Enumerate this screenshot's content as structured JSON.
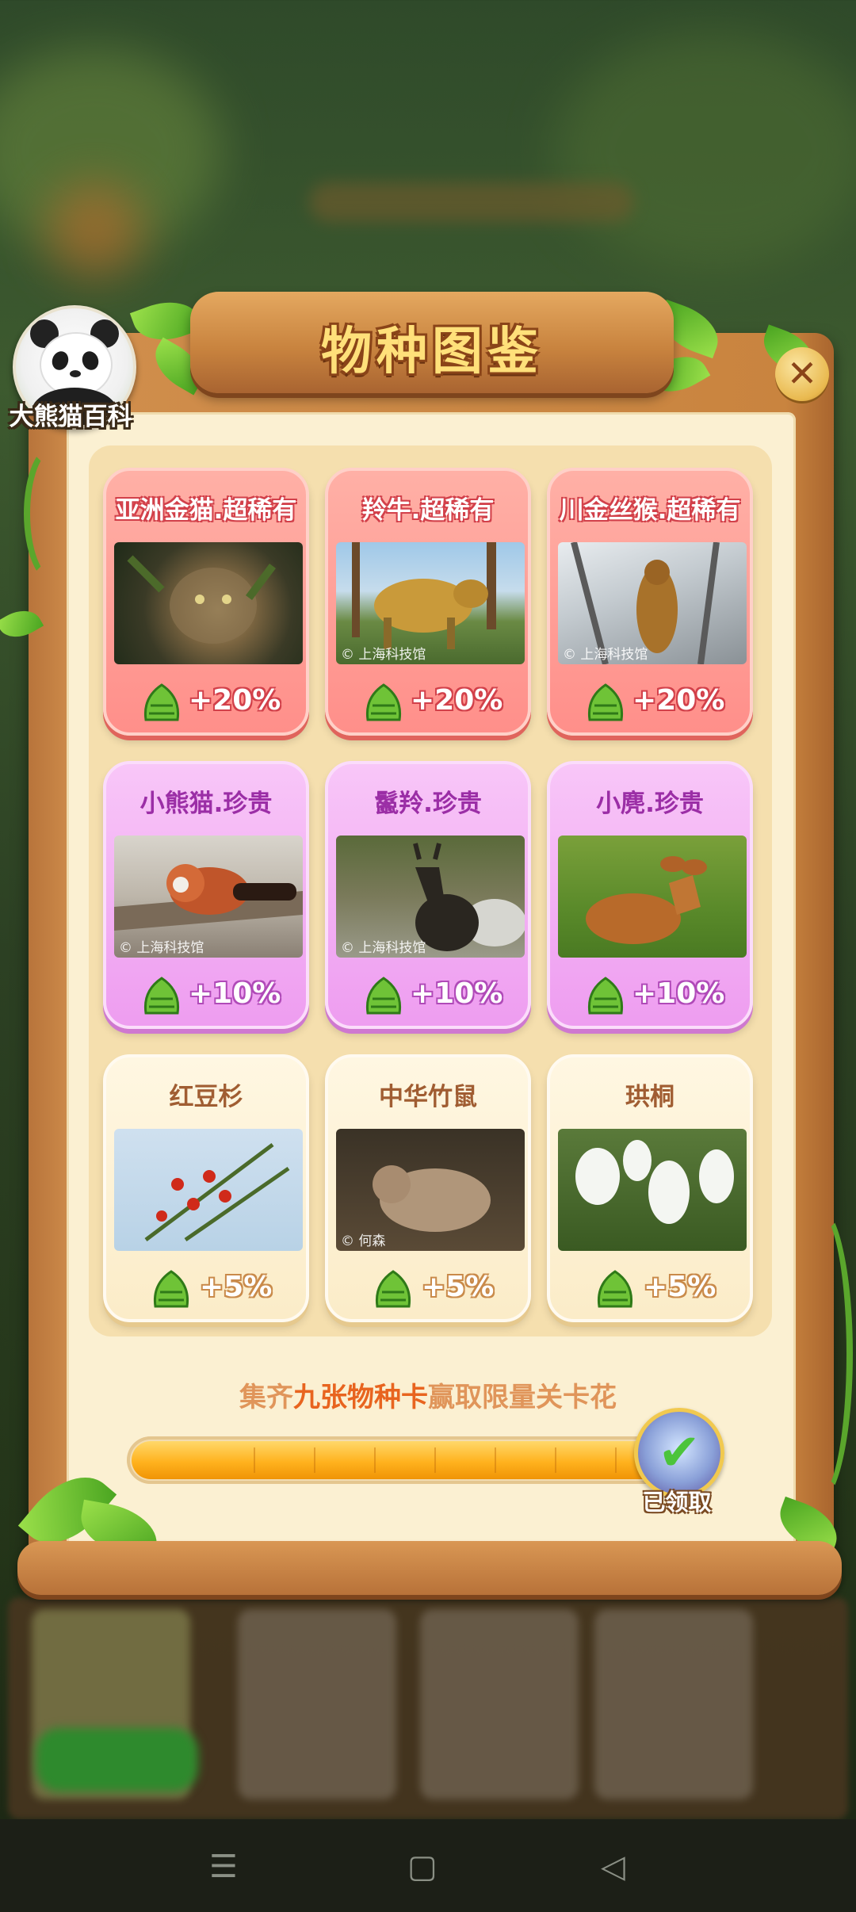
{
  "avatar": {
    "label": "大熊猫百科"
  },
  "dialog": {
    "title": "物种图鉴",
    "close_icon": "close-icon"
  },
  "cards": [
    {
      "name": "亚洲金猫.超稀有",
      "tier": "super-rare",
      "bonus": "+20%",
      "credit": ""
    },
    {
      "name": "羚牛.超稀有",
      "tier": "super-rare",
      "bonus": "+20%",
      "credit": "© 上海科技馆"
    },
    {
      "name": "川金丝猴.超稀有",
      "tier": "super-rare",
      "bonus": "+20%",
      "credit": "© 上海科技馆"
    },
    {
      "name": "小熊猫.珍贵",
      "tier": "rare",
      "bonus": "+10%",
      "credit": "© 上海科技馆"
    },
    {
      "name": "鬣羚.珍贵",
      "tier": "rare",
      "bonus": "+10%",
      "credit": "© 上海科技馆"
    },
    {
      "name": "小麂.珍贵",
      "tier": "rare",
      "bonus": "+10%",
      "credit": ""
    },
    {
      "name": "红豆杉",
      "tier": "common",
      "bonus": "+5%",
      "credit": ""
    },
    {
      "name": "中华竹鼠",
      "tier": "common",
      "bonus": "+5%",
      "credit": "© 何森"
    },
    {
      "name": "珙桐",
      "tier": "common",
      "bonus": "+5%",
      "credit": ""
    }
  ],
  "collection": {
    "prefix": "集齐",
    "highlight": "九张物种卡",
    "suffix": "赢取限量关卡花",
    "progress": 1.0,
    "reward_status": "已领取"
  },
  "colors": {
    "super_rare": "#ff8f8a",
    "rare": "#ee9df0",
    "common": "#fbecc8",
    "accent": "#e8641f"
  }
}
